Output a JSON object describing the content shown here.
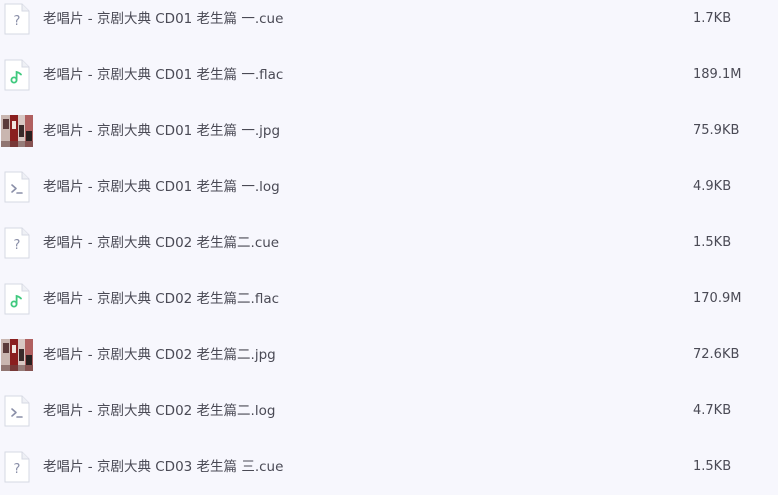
{
  "files": [
    {
      "name": "老唱片 - 京剧大典 CD01 老生篇 一.cue",
      "size": "1.7KB",
      "icon": "unknown-file-icon"
    },
    {
      "name": "老唱片 - 京剧大典 CD01 老生篇 一.flac",
      "size": "189.1M",
      "icon": "audio-file-icon"
    },
    {
      "name": "老唱片 - 京剧大典 CD01 老生篇 一.jpg",
      "size": "75.9KB",
      "icon": "image-thumbnail-icon"
    },
    {
      "name": "老唱片 - 京剧大典 CD01 老生篇 一.log",
      "size": "4.9KB",
      "icon": "log-file-icon"
    },
    {
      "name": "老唱片 - 京剧大典 CD02 老生篇二.cue",
      "size": "1.5KB",
      "icon": "unknown-file-icon"
    },
    {
      "name": "老唱片 - 京剧大典 CD02 老生篇二.flac",
      "size": "170.9M",
      "icon": "audio-file-icon"
    },
    {
      "name": "老唱片 - 京剧大典 CD02 老生篇二.jpg",
      "size": "72.6KB",
      "icon": "image-thumbnail-icon"
    },
    {
      "name": "老唱片 - 京剧大典 CD02 老生篇二.log",
      "size": "4.7KB",
      "icon": "log-file-icon"
    },
    {
      "name": "老唱片 - 京剧大典 CD03 老生篇 三.cue",
      "size": "1.5KB",
      "icon": "unknown-file-icon"
    }
  ],
  "colors": {
    "background": "#f7f7fd",
    "text": "#4a4a55",
    "audio_accent": "#3fc97e",
    "generic_icon": "#8a8fa8"
  }
}
